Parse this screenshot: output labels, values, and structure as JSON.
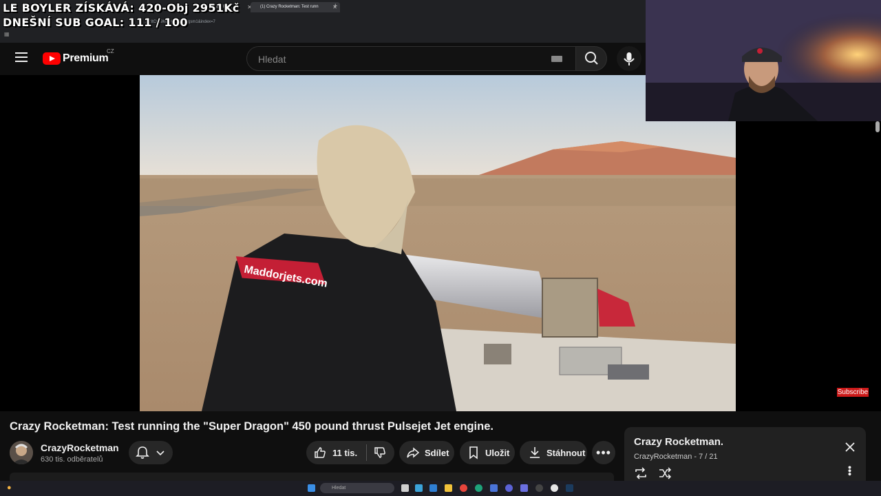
{
  "overlay": {
    "line1": "LE BOYLER ZÍSKÁVÁ: 420-Obj 2951Kč",
    "line2": "DNEŠNÍ SUB GOAL:  111 / 100"
  },
  "browser": {
    "tabs": [
      {
        "label": "the Intern"
      },
      {
        "label": "(1) Crazy Rocketman: Test runn"
      }
    ],
    "address": "…2ItCvy9KCQpl1M4V5gsm1&index=7"
  },
  "header": {
    "logo_text": "Premium",
    "country_code": "CZ",
    "search_placeholder": "Hledat"
  },
  "video": {
    "title": "Crazy Rocketman: Test running the \"Super Dragon\" 450 pound thrust Pulsejet Jet engine.",
    "jacket_text": "Maddorjets.com",
    "subscribe_overlay": "Subscribe"
  },
  "channel": {
    "name": "CrazyRocketman",
    "subscribers": "630 tis. odběratelů"
  },
  "actions": {
    "likes": "11 tis.",
    "share": "Sdílet",
    "save": "Uložit",
    "download": "Stáhnout"
  },
  "playlist": {
    "title": "Crazy Rocketman.",
    "subtitle": "CrazyRocketman - 7 / 21"
  },
  "taskbar": {
    "search_label": "Hledat"
  },
  "colors": {
    "brand_red": "#ff0000",
    "page_bg": "#0f0f0f",
    "pill_bg": "#272727"
  }
}
